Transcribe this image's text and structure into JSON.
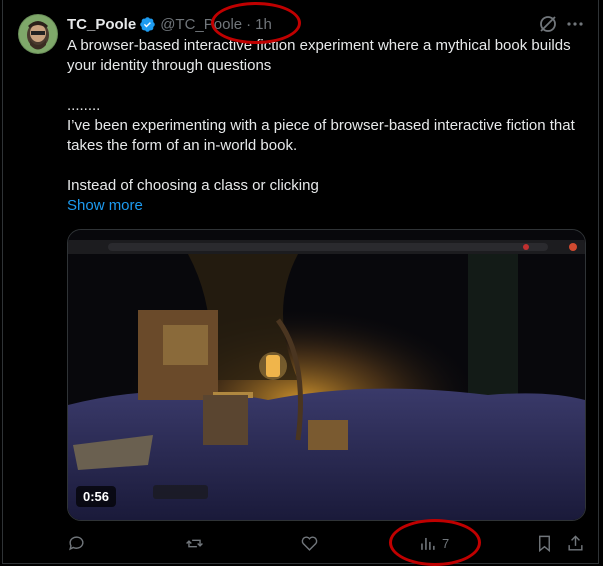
{
  "tweet": {
    "display_name": "TC_Poole",
    "handle": "@TC_Poole",
    "separator": "·",
    "time": "1h",
    "text_line1": "A browser-based interactive fiction experiment where a mythical book builds your identity through questions",
    "dots": "........",
    "text_para2": "I’ve been experimenting with a piece of browser-based interactive fiction that takes the form of an in-world book.",
    "text_para3": "Instead of choosing a class or clicking",
    "show_more": "Show more"
  },
  "media": {
    "duration": "0:56"
  },
  "actions": {
    "views_count": "7"
  },
  "icons": {
    "verified": "verified-badge-icon",
    "grok": "grok-icon",
    "more": "more-icon",
    "reply": "reply-icon",
    "retweet": "retweet-icon",
    "like": "like-icon",
    "views": "views-icon",
    "bookmark": "bookmark-icon",
    "share": "share-icon"
  },
  "colors": {
    "link": "#1d9bf0",
    "muted": "#71767b",
    "text": "#e7e9ea",
    "annotation": "#c00000"
  }
}
